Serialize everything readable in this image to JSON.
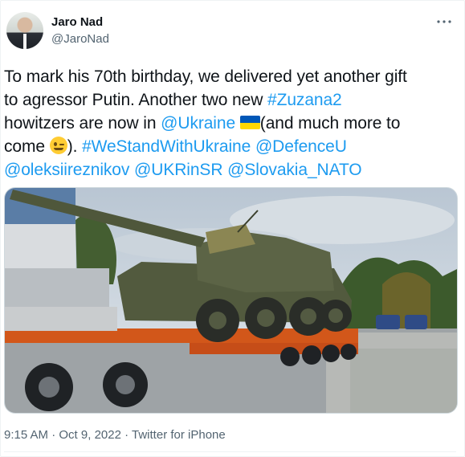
{
  "author": {
    "name": "Jaro Nad",
    "handle": "@JaroNad"
  },
  "more_icon": "more-horizontal-icon",
  "tweet": {
    "line1": "To mark his 70th birthday, we delivered yet another gift",
    "line2": "to agressor Putin. Another two new ",
    "hashtag_zuzana": "#Zuzana2",
    "line3_a": "howitzers are now in ",
    "mention_ukraine": "@Ukraine",
    "line3_b": "(and much more to",
    "line4_a": "come ",
    "line4_b": "). ",
    "hashtag_standwith": "#WeStandWithUkraine",
    "mention_defence": "@DefenceU",
    "mention_oleksii": "@oleksiireznikov",
    "mention_ukrinsr": "@UKRinSR",
    "mention_nato": "@Slovakia_NATO",
    "flag_colors": [
      "#0057b7",
      "#ffd700"
    ],
    "emoji": "winking-face"
  },
  "meta": {
    "time": "9:15 AM",
    "separator1": " · ",
    "date": "Oct 9, 2022",
    "separator2": " · ",
    "source": "Twitter for iPhone"
  },
  "colors": {
    "link": "#1d9bf0",
    "secondary_text": "#536471"
  }
}
